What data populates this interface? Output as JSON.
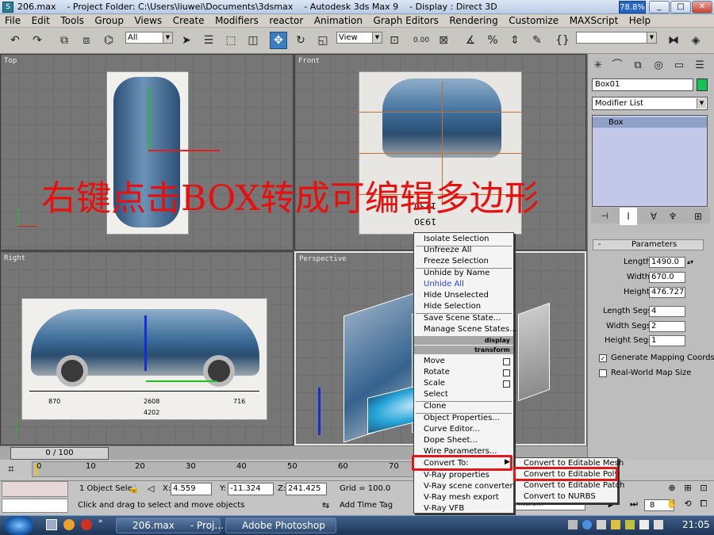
{
  "title_bar": {
    "icon": "3ds-max-logo-icon",
    "text": "206.max    - Project Folder: C:\\Users\\liuwei\\Documents\\3dsmax    - Autodesk 3ds Max 9    - Display : Direct 3D",
    "cpu_meter": "78.8%"
  },
  "menu": [
    "File",
    "Edit",
    "Tools",
    "Group",
    "Views",
    "Create",
    "Modifiers",
    "reactor",
    "Animation",
    "Graph Editors",
    "Rendering",
    "Customize",
    "MAXScript",
    "Help"
  ],
  "toolbar": {
    "selection_filter": "All",
    "reference_coord": "View"
  },
  "viewports": {
    "top": "Top",
    "front": "Front",
    "right": "Right",
    "perspective": "Perspective"
  },
  "front_dims": {
    "dim_a": "1730",
    "dim_b": "1930"
  },
  "right_dims": {
    "a": "870",
    "b": "2608",
    "c": "716",
    "d": "4202"
  },
  "overlay_text": "右键点击BOX转成可编辑多边形",
  "command_panel": {
    "object_name": "Box01",
    "modifier_list": "Modifier List",
    "stack_item": "Box",
    "rollout": "Parameters",
    "length_label": "Length:",
    "length": "1490.0",
    "width_label": "Width:",
    "width": "670.0",
    "height_label": "Height:",
    "height": "476.727",
    "lsegs_label": "Length Segs:",
    "lsegs": "4",
    "wsegs_label": "Width Segs:",
    "wsegs": "2",
    "hsegs_label": "Height Segs:",
    "hsegs": "1",
    "gen_map": "Generate Mapping Coords.",
    "real_world": "Real-World Map Size"
  },
  "timeline": {
    "frame": "0 / 100",
    "ticks": [
      "0",
      "10",
      "20",
      "30",
      "40",
      "50",
      "60",
      "70"
    ]
  },
  "status": {
    "selected": "1 Object Sele",
    "x_label": "X:",
    "x": "4.559",
    "y_label": "Y:",
    "y": "-11.324",
    "z_label": "Z:",
    "z": "241.425",
    "grid": "Grid = 100.0",
    "prompt": "Click and drag to select and move objects",
    "add_time_tag": "Add Time Tag",
    "filters": "Filters..."
  },
  "quad_menu": {
    "items_a": [
      "Isolate Selection",
      "Unfreeze All",
      "Freeze Selection"
    ],
    "unhide_by_name": "Unhide by Name",
    "unhide_all": "Unhide All",
    "items_b": [
      "Hide Unselected",
      "Hide Selection"
    ],
    "items_c": [
      "Save Scene State...",
      "Manage Scene States..."
    ],
    "hdr_display": "display",
    "hdr_transform": "transform",
    "items_d": [
      "Move",
      "Rotate",
      "Scale",
      "Select"
    ],
    "clone": "Clone",
    "items_e": [
      "Object Properties...",
      "Curve Editor...",
      "Dope Sheet...",
      "Wire Parameters..."
    ],
    "convert_to": "Convert To:",
    "items_f": [
      "V-Ray properties",
      "V-Ray scene converter",
      "V-Ray mesh export",
      "V-Ray VFB"
    ]
  },
  "submenu": [
    "Convert to Editable Mesh",
    "Convert to Editable Poly",
    "Convert to Editable Patch",
    "Convert to NURBS"
  ],
  "highlighted": "Convert to Editable Poly",
  "taskbar": {
    "task1": "206.max",
    "task1b": "- Proj...",
    "task2": "Adobe Photoshop",
    "clock": "21:05",
    "spinner": "8"
  }
}
